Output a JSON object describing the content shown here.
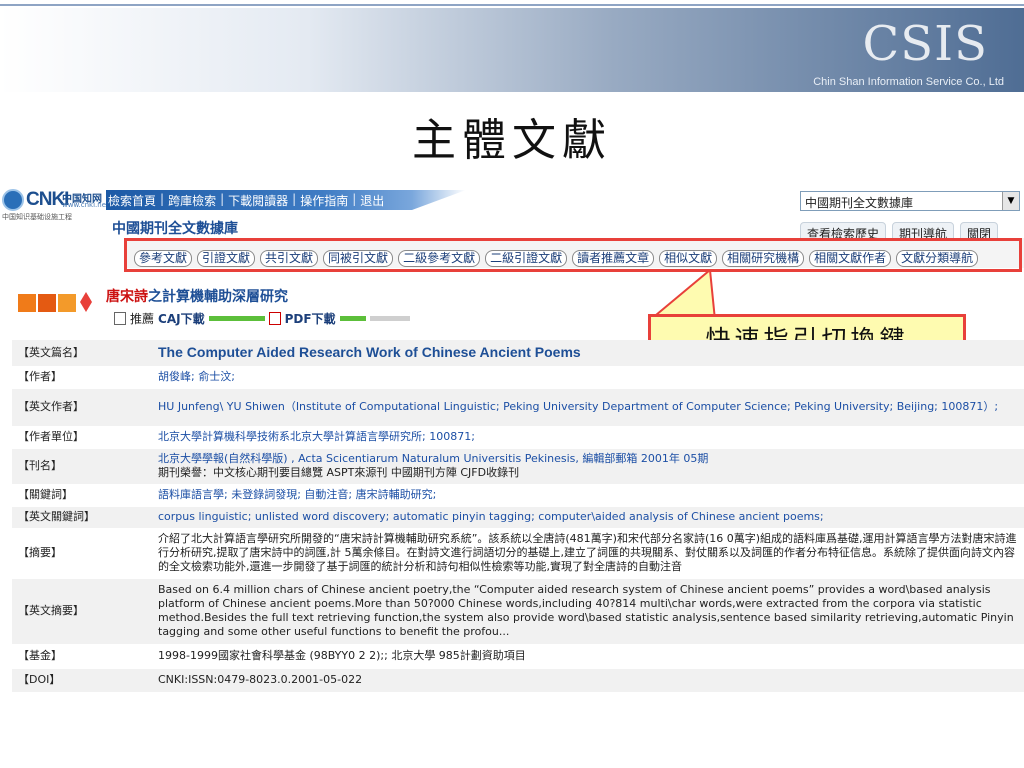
{
  "banner": {
    "logo": "CSIS",
    "company": "Chin Shan Information Service Co., Ltd",
    "slide_title": "主體文獻"
  },
  "cnki": {
    "logo_text": "CNKI",
    "logo_cn": "中国知网",
    "logo_url": "www.cnki.net",
    "logo_sub": "中国知识基础设施工程",
    "top_nav": [
      "檢索首頁",
      "跨庫檢索",
      "下載閱讀器",
      "操作指南",
      "退出"
    ],
    "db_title": "中國期刊全文數據庫",
    "db_select_value": "中國期刊全文數據庫",
    "right_tabs": [
      "查看檢索歷史",
      "期刊導航",
      "關閉"
    ]
  },
  "quick_links": [
    "參考文獻",
    "引證文獻",
    "共引文獻",
    "同被引文獻",
    "二級參考文獻",
    "二級引證文獻",
    "讀者推薦文章",
    "相似文獻",
    "相關研究機構",
    "相關文獻作者",
    "文獻分類導航"
  ],
  "callout": "快速指引切換鍵",
  "article": {
    "title_red": "唐宋詩",
    "title_rest": "之計算機輔助深層研究",
    "recommend": "推薦",
    "caj_download": "CAJ下載",
    "pdf_download": "PDF下載"
  },
  "rows": [
    {
      "label": "【英文篇名】",
      "value": "The Computer Aided Research Work of Chinese Ancient Poems",
      "kind": "title"
    },
    {
      "label": "【作者】",
      "value": "胡俊峰; 俞士汶;",
      "kind": "link"
    },
    {
      "label": "【英文作者】",
      "value": "HU Junfeng\\ YU Shiwen（Institute of Computational Linguistic; Peking University Department of Computer Science; Peking University; Beijing; 100871）;",
      "kind": "link"
    },
    {
      "label": "【作者單位】",
      "value": "北京大學計算機科學技術系北京大學計算語言學研究所; 100871;",
      "kind": "link"
    },
    {
      "label": "【刊名】",
      "value": "北京大學學報(自然科學版) , Acta Scicentiarum Naturalum Universitis Pekinesis, 編輯部郵箱 2001年 05期",
      "value2": "期刊榮譽：中文核心期刊要目總覽  ASPT來源刊  中國期刊方陣  CJFD收錄刊",
      "kind": "link"
    },
    {
      "label": "【關鍵詞】",
      "value": "語料庫語言學; 未登錄詞發現; 自動注音; 唐宋詩輔助研究;",
      "kind": "link"
    },
    {
      "label": "【英文關鍵詞】",
      "value": "corpus linguistic; unlisted word discovery; automatic pinyin tagging; computer\\aided analysis of Chinese ancient poems;",
      "kind": "link"
    },
    {
      "label": "【摘要】",
      "value": "介紹了北大計算語言學研究所開發的“唐宋詩計算機輔助研究系統”。該系統以全唐詩(481萬字)和宋代部分名家詩(16 0萬字)組成的語料庫爲基礎,運用計算語言學方法對唐宋詩進行分析研究,提取了唐宋詩中的詞匯,計 5萬余條目。在對詩文進行詞語切分的基礎上,建立了詞匯的共現關系、對仗關系以及詞匯的作者分布特征信息。系統除了提供面向詩文內容的全文檢索功能外,還進一步開發了基于詞匯的統計分析和詩句相似性檢索等功能,實現了對全唐詩的自動注音",
      "kind": "plain"
    },
    {
      "label": "【英文摘要】",
      "value": "Based on 6.4 million chars of Chinese ancient poetry,the “Computer aided research system of Chinese ancient poems” provides a word\\based analysis platform of Chinese ancient poems.More than 50?000 Chinese words,including 40?814 multi\\char words,were extracted from the corpora via statistic method.Besides the full text retrieving function,the system also provide word\\based statistic analysis,sentence based similarity retrieving,automatic Pinyin tagging and some other useful functions to benefit the profou...",
      "kind": "plain"
    },
    {
      "label": "【基金】",
      "value": "1998-1999國家社會科學基金 (98BYY0 2 2);; 北京大學 985計劃資助項目",
      "kind": "plain"
    },
    {
      "label": "【DOI】",
      "value": "CNKI:ISSN:0479-8023.0.2001-05-022",
      "kind": "plain"
    }
  ]
}
